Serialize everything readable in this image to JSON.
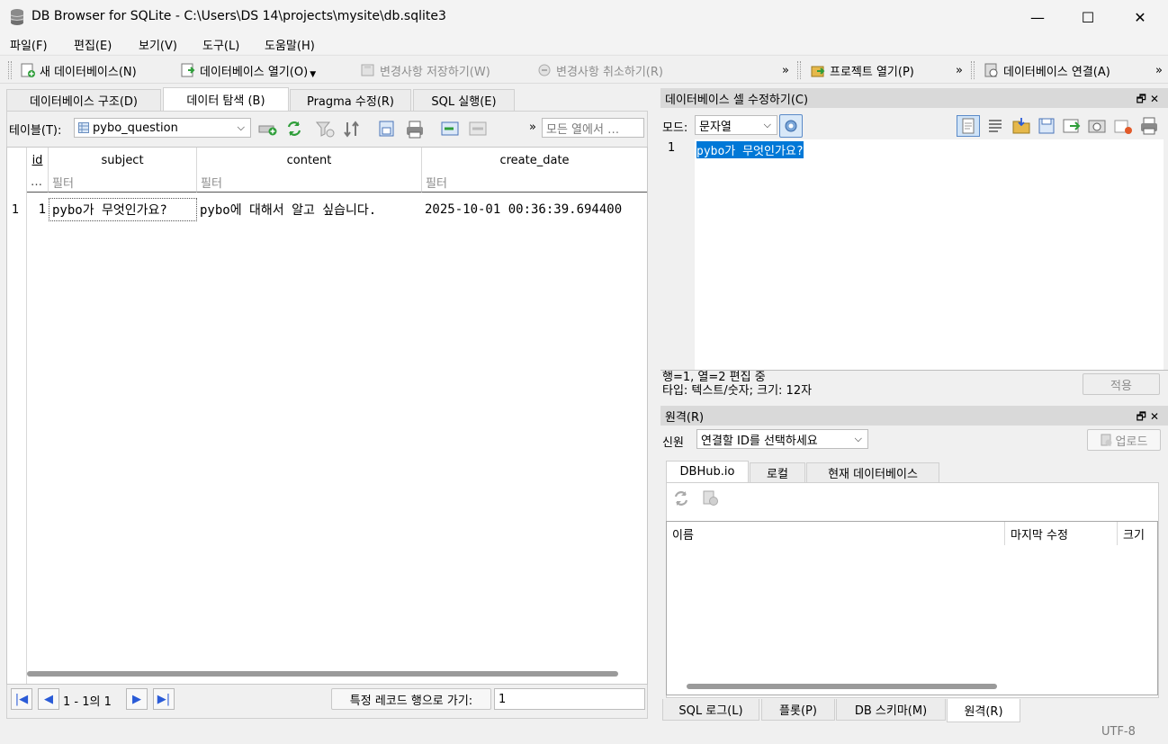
{
  "window": {
    "title": "DB Browser for SQLite - C:\\Users\\DS 14\\projects\\mysite\\db.sqlite3",
    "minimize": "—",
    "maximize": "☐",
    "close": "✕"
  },
  "menu": [
    "파일(F)",
    "편집(E)",
    "보기(V)",
    "도구(L)",
    "도움말(H)"
  ],
  "toolbar": {
    "new_db": "새 데이터베이스(N)",
    "open_db": "데이터베이스 열기(O)",
    "write_changes": "변경사항 저장하기(W)",
    "revert_changes": "변경사항 취소하기(R)",
    "open_project": "프로젝트 열기(P)",
    "attach_db": "데이터베이스 연결(A)",
    "more": "»"
  },
  "main_tabs": [
    "데이터베이스 구조(D)",
    "데이터 탐색 (B)",
    "Pragma 수정(R)",
    "SQL 실행(E)"
  ],
  "browse": {
    "table_label": "테이블(T):",
    "table_name": "pybo_question",
    "filter_all_placeholder": "모든 열에서 …",
    "more": "»",
    "columns": [
      "id",
      "subject",
      "content",
      "create_date"
    ],
    "filter_placeholder": "필터",
    "row_corner_filter": "…",
    "rows": [
      {
        "rownum": "1",
        "id": "1",
        "subject": "pybo가 무엇인가요?",
        "content": "pybo에 대해서 알고 싶습니다.",
        "create_date": "2025-10-01 00:36:39.694400"
      }
    ],
    "page_info": "1 - 1의 1",
    "goto_label": "특정 레코드 행으로 가기:",
    "goto_value": "1"
  },
  "cell_editor": {
    "title": "데이터베이스 셀 수정하기(C)",
    "mode_label": "모드:",
    "mode_value": "문자열",
    "line_number": "1",
    "content": "pybo가 무엇인가요?",
    "status_line1": "행=1, 열=2 편집 중",
    "status_line2": "타입: 텍스트/숫자; 크기: 12자",
    "apply": "적용"
  },
  "remote": {
    "title": "원격(R)",
    "identity_label": "신원",
    "identity_value": "연결할 ID를 선택하세요",
    "upload": "업로드",
    "tabs": [
      "DBHub.io",
      "로컬",
      "현재 데이터베이스"
    ],
    "columns": [
      "이름",
      "마지막 수정",
      "크기"
    ]
  },
  "bottom_tabs": [
    "SQL 로그(L)",
    "플롯(P)",
    "DB 스키마(M)",
    "원격(R)"
  ],
  "statusbar": {
    "encoding": "UTF-8"
  },
  "colors": {
    "selection": "#0078d7",
    "nav_blue": "#2a5bd7"
  }
}
